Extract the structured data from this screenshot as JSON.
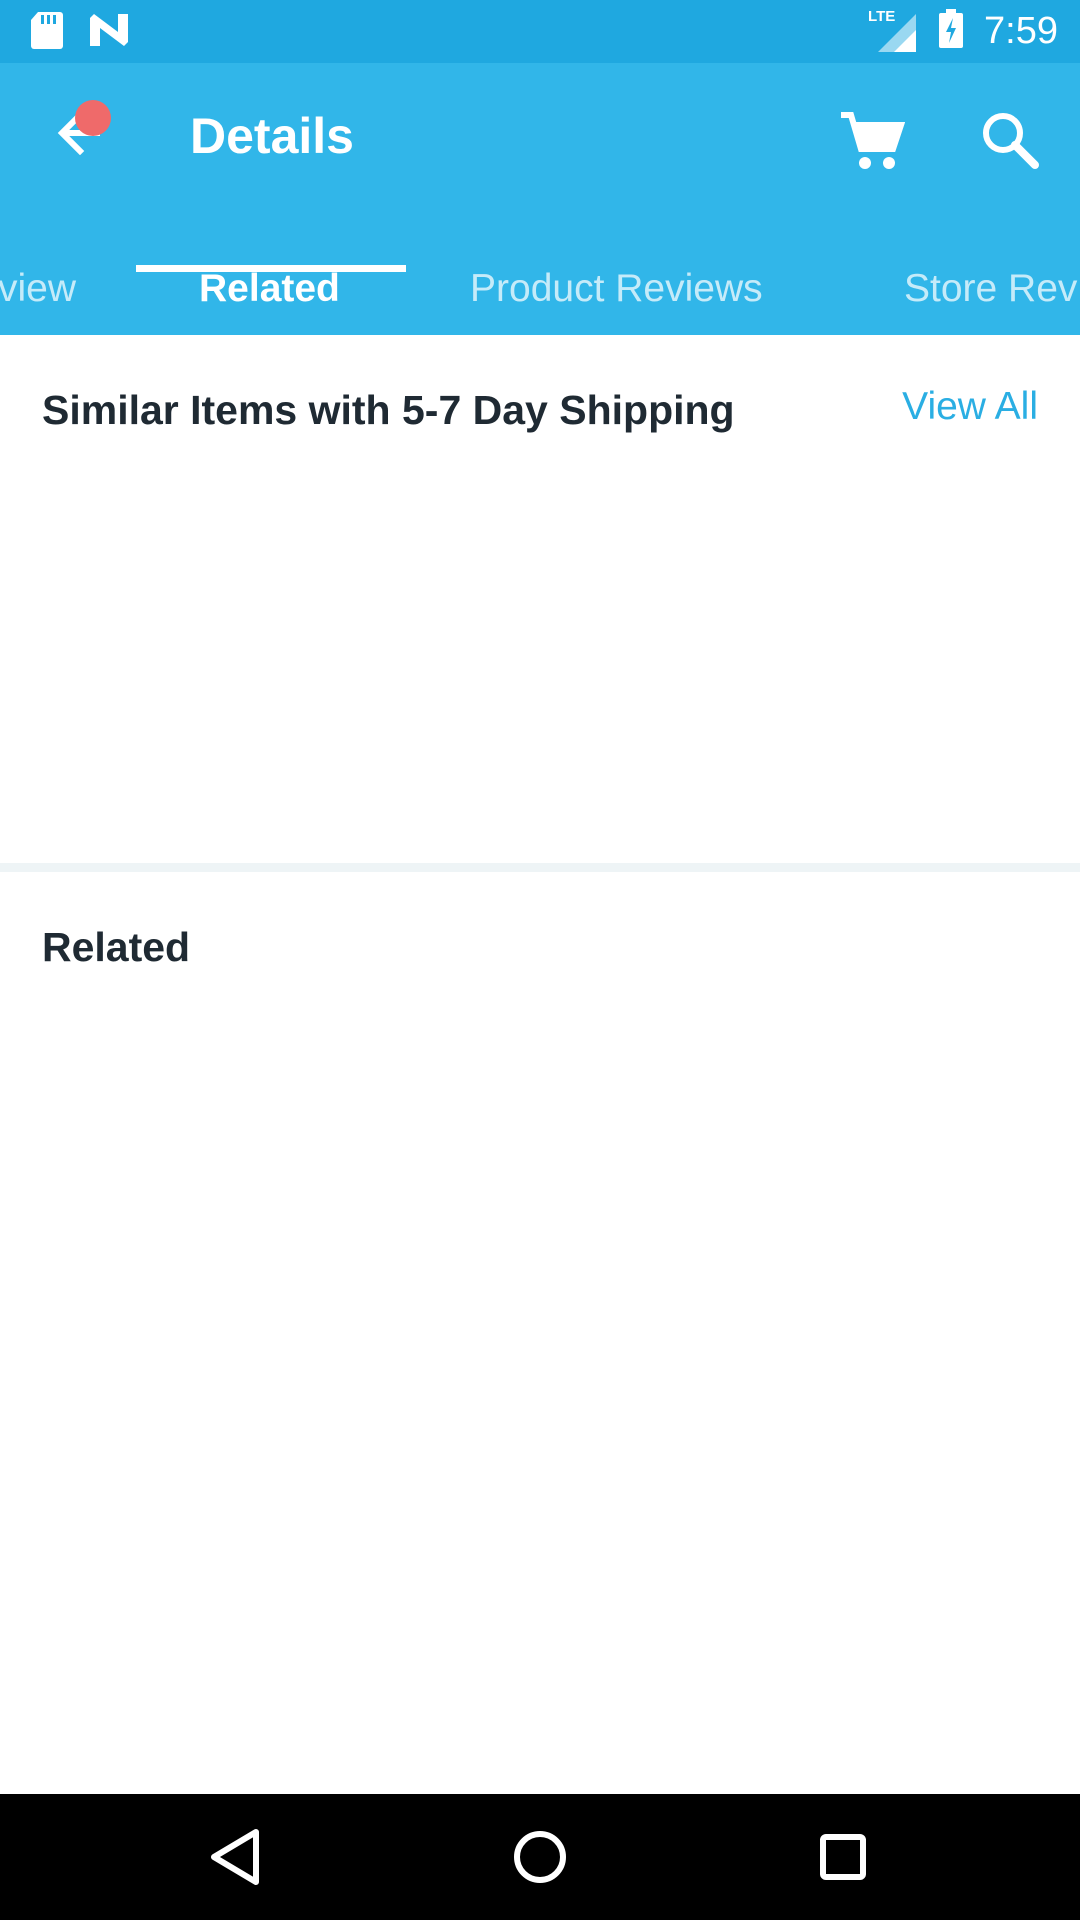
{
  "status_bar": {
    "time": "7:59",
    "network": "LTE",
    "icons": [
      "sd-card-icon",
      "n-logo-icon",
      "signal-icon",
      "battery-charging-icon"
    ]
  },
  "app_bar": {
    "title": "Details",
    "back_icon": "arrow-back-icon",
    "cart_icon": "cart-icon",
    "search_icon": "search-icon",
    "notification_dot_color": "#ef6a6a"
  },
  "tabs": [
    {
      "label": "view",
      "active": false
    },
    {
      "label": "Related",
      "active": true
    },
    {
      "label": "Product Reviews",
      "active": false
    },
    {
      "label": "Store Rev",
      "active": false
    }
  ],
  "sections": {
    "similar": {
      "title": "Similar Items with 5-7 Day Shipping",
      "view_all": "View All"
    },
    "related": {
      "title": "Related"
    }
  },
  "colors": {
    "status_bar": "#1fa8e0",
    "app_bar": "#31b6e9",
    "accent": "#2aaee3",
    "heading_text": "#1f2a33"
  },
  "nav_bar": {
    "icons": [
      "back-triangle-icon",
      "home-circle-icon",
      "recents-square-icon"
    ]
  }
}
